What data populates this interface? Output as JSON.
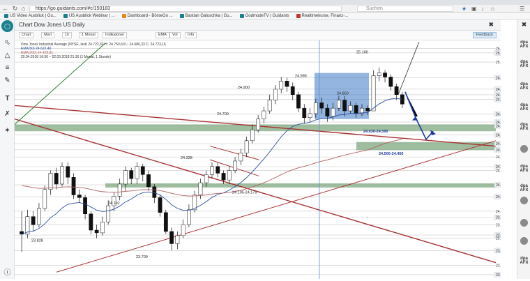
{
  "browser": {
    "url": "https://go.guidants.com/#c/150183",
    "search_placeholder": "Suchen",
    "bookmarks": [
      {
        "label": "US Video Ausblick | Gu...",
        "color": "#1a7f8e"
      },
      {
        "label": "US Ausblick Webinar | ...",
        "color": "#1a7f8e"
      },
      {
        "label": "Dashboard - BörseGo ...",
        "color": "#e08a1e"
      },
      {
        "label": "Bastian Galuschka | Gu...",
        "color": "#1a7f8e"
      },
      {
        "label": "GodmodeTV | Guidants",
        "color": "#1a7f8e"
      },
      {
        "label": "Realtimekurse, Finanz-...",
        "color": "#c0392b"
      }
    ]
  },
  "chart_header": {
    "title": "Chart Dow Jones US Daily",
    "toolbar": [
      "Chart",
      "Mart",
      "1h",
      "1 Monat",
      "Indikatoren",
      "EMA",
      "Vol",
      "Info"
    ],
    "feedback": "Feedback"
  },
  "legend": {
    "line1": "Dow Jones Industrial Average (NYSE, last)   24.722,32  H: 24.750,60  L: 24.686,33  C: 24.723,16",
    "line2": "EMA(50)   24.622,46",
    "line3": "EMA(200)   24.429,81",
    "line4": "20.04.2018 16:30 – 22.05.2018 21:30  (1 Monat, 1 Stunde)"
  },
  "right_sidebar": {
    "tools": [
      "dpa AFX",
      "dpa AFX",
      "dpa AFX",
      "dpa AFX",
      "dpa AFX",
      "dpa AFX",
      "dpa AFX",
      "dpa AFX",
      "dpa AFX",
      "dpa AFX"
    ]
  },
  "chart_data": {
    "type": "candlestick",
    "title": "",
    "yaxis_labels": [
      "25.200,00",
      "25.168,51",
      "25.100,00",
      "24.985,24",
      "24.900,52",
      "24.858,97",
      "24.824,41",
      "24.717,50",
      "24.657,45",
      "24.629,20",
      "24.562,12",
      "24.498,23",
      "24.453,14",
      "24.400,00",
      "24.328,54",
      "24.300,00",
      "24.194,45",
      "24.106,25",
      "24.000,00",
      "23.954,83",
      "23.900,00",
      "23.823,73",
      "23.800,00",
      "23.708,73",
      "23.600,00",
      "23.531,31"
    ],
    "ylim": [
      23500,
      25260
    ],
    "annotations": [
      "25.160",
      "24.985",
      "24.900",
      "24.859",
      "24.700",
      "24.630-24.590",
      "24.500-24.450",
      "24.328",
      "24.195-24.175",
      "24.110",
      "23.828",
      "23.709"
    ],
    "zones": [
      {
        "label": "24.630-24.590",
        "from": 24590,
        "to": 24630
      },
      {
        "label": "24.500-24.450",
        "from": 24450,
        "to": 24500
      },
      {
        "label": "24.195-24.175",
        "from": 24175,
        "to": 24195
      }
    ],
    "candles": [
      [
        23850,
        23830,
        24000,
        23700
      ],
      [
        23830,
        23960,
        24010,
        23800
      ],
      [
        23960,
        23900,
        24000,
        23850
      ],
      [
        23900,
        24020,
        24060,
        23880
      ],
      [
        24020,
        24160,
        24190,
        24000
      ],
      [
        24160,
        24280,
        24300,
        24120
      ],
      [
        24280,
        24200,
        24320,
        24160
      ],
      [
        24200,
        24330,
        24360,
        24180
      ],
      [
        24330,
        24250,
        24360,
        24200
      ],
      [
        24250,
        24120,
        24280,
        24090
      ],
      [
        24120,
        24100,
        24160,
        24060
      ],
      [
        24100,
        23980,
        24120,
        23940
      ],
      [
        23980,
        23860,
        24000,
        23830
      ],
      [
        23860,
        23840,
        23900,
        23800
      ],
      [
        23840,
        23920,
        23960,
        23820
      ],
      [
        23920,
        24040,
        24080,
        23900
      ],
      [
        24040,
        24110,
        24140,
        24000
      ],
      [
        24110,
        24200,
        24240,
        24080
      ],
      [
        24200,
        24300,
        24330,
        24150
      ],
      [
        24300,
        24240,
        24320,
        24200
      ],
      [
        24240,
        24330,
        24360,
        24200
      ],
      [
        24330,
        24270,
        24350,
        24220
      ],
      [
        24270,
        24180,
        24300,
        24150
      ],
      [
        24180,
        24100,
        24200,
        24060
      ],
      [
        24100,
        23990,
        24120,
        23960
      ],
      [
        23990,
        23850,
        24010,
        23830
      ],
      [
        23850,
        23760,
        23880,
        23710
      ],
      [
        23760,
        23820,
        23850,
        23720
      ],
      [
        23820,
        23900,
        23940,
        23800
      ],
      [
        23900,
        24010,
        24050,
        23880
      ],
      [
        24010,
        24120,
        24150,
        23990
      ],
      [
        24120,
        24210,
        24240,
        24090
      ],
      [
        24210,
        24270,
        24300,
        24180
      ],
      [
        24270,
        24330,
        24360,
        24240
      ],
      [
        24330,
        24280,
        24360,
        24250
      ],
      [
        24280,
        24230,
        24300,
        24200
      ],
      [
        24230,
        24300,
        24330,
        24200
      ],
      [
        24300,
        24370,
        24400,
        24280
      ],
      [
        24370,
        24430,
        24460,
        24340
      ],
      [
        24430,
        24520,
        24550,
        24400
      ],
      [
        24520,
        24600,
        24640,
        24500
      ],
      [
        24600,
        24680,
        24710,
        24580
      ],
      [
        24680,
        24740,
        24770,
        24650
      ],
      [
        24740,
        24820,
        24860,
        24720
      ],
      [
        24820,
        24900,
        24930,
        24790
      ],
      [
        24900,
        24960,
        24990,
        24870
      ],
      [
        24960,
        24920,
        24985,
        24880
      ],
      [
        24920,
        24860,
        24950,
        24820
      ],
      [
        24860,
        24760,
        24880,
        24730
      ],
      [
        24760,
        24690,
        24790,
        24650
      ],
      [
        24690,
        24720,
        24760,
        24660
      ],
      [
        24720,
        24800,
        24830,
        24690
      ],
      [
        24800,
        24760,
        24840,
        24720
      ],
      [
        24760,
        24700,
        24790,
        24660
      ],
      [
        24700,
        24760,
        24800,
        24670
      ],
      [
        24760,
        24820,
        24850,
        24740
      ],
      [
        24820,
        24740,
        24850,
        24700
      ],
      [
        24740,
        24780,
        24810,
        24720
      ],
      [
        24780,
        24720,
        24800,
        24690
      ],
      [
        24720,
        24760,
        24790,
        24700
      ],
      [
        24760,
        24740,
        24780,
        24710
      ],
      [
        24740,
        25000,
        25040,
        24740
      ],
      [
        25000,
        25020,
        25060,
        24960
      ],
      [
        25020,
        24990,
        25040,
        24950
      ],
      [
        24990,
        24920,
        25010,
        24890
      ],
      [
        24920,
        24860,
        24940,
        24820
      ],
      [
        24860,
        24790,
        24880,
        24760
      ]
    ]
  }
}
